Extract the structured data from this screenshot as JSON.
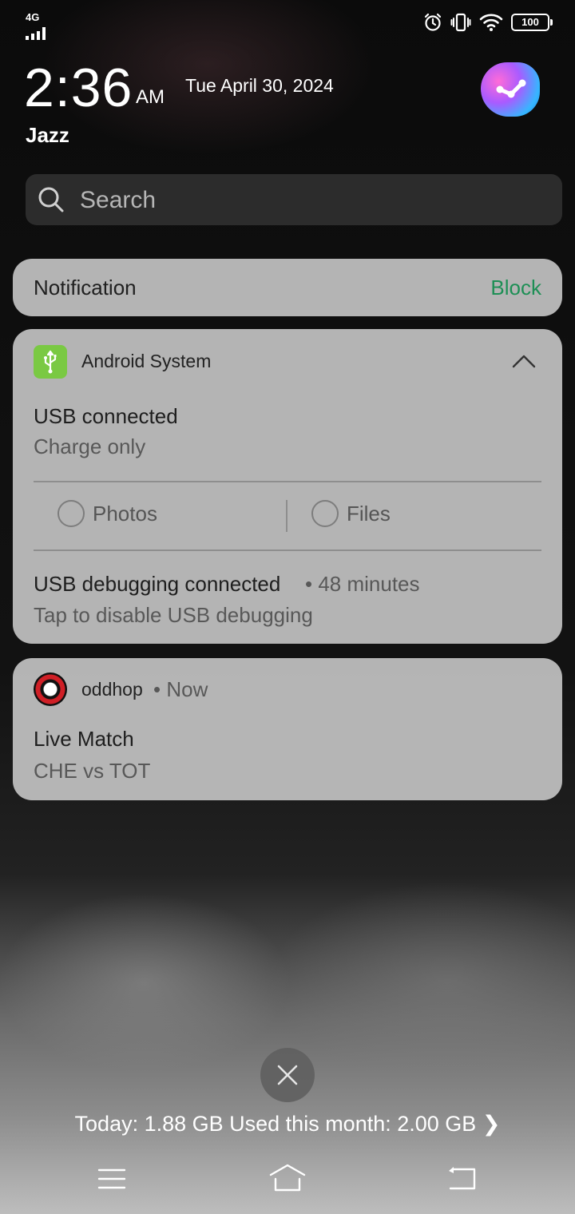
{
  "status_bar": {
    "network": "4G",
    "battery": "100",
    "icons": [
      "alarm-icon",
      "vibrate-icon",
      "wifi-icon",
      "battery-icon"
    ]
  },
  "header": {
    "time": "2:36",
    "ampm": "AM",
    "date": "Tue April 30, 2024",
    "carrier": "Jazz"
  },
  "search": {
    "placeholder": "Search"
  },
  "notification_bar": {
    "label": "Notification",
    "action": "Block",
    "action_color": "#1d8f55"
  },
  "android_notification": {
    "app": "Android System",
    "title": "USB connected",
    "subtitle": "Charge only",
    "options": [
      "Photos",
      "Files"
    ],
    "debug_title": "USB debugging connected",
    "debug_time": "• 48 minutes",
    "debug_sub": "Tap to disable USB debugging",
    "icon": "usb-icon",
    "icon_color": "#7ac943"
  },
  "oddhop_notification": {
    "app": "oddhop",
    "time": "• Now",
    "title": "Live Match",
    "subtitle": "CHE vs TOT"
  },
  "footer": {
    "data_usage": "Today: 1.88 GB Used this month: 2.00 GB",
    "chevron": "❯"
  }
}
